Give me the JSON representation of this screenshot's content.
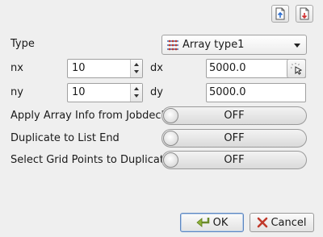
{
  "toolbar": {
    "icons": [
      "import-file-icon",
      "export-file-icon"
    ]
  },
  "form": {
    "type_label": "Type",
    "type_value": "Array type1",
    "nx_label": "nx",
    "nx_value": "10",
    "dx_label": "dx",
    "dx_value": "5000.0",
    "ny_label": "ny",
    "ny_value": "10",
    "dy_label": "dy",
    "dy_value": "5000.0"
  },
  "toggles": [
    {
      "label": "Apply Array Info from Jobdeck",
      "state": "OFF"
    },
    {
      "label": "Duplicate to List End",
      "state": "OFF"
    },
    {
      "label": "Select Grid Points to Duplicate",
      "state": "OFF"
    }
  ],
  "buttons": {
    "ok": "OK",
    "cancel": "Cancel"
  },
  "colors": {
    "background": "#efefef",
    "ok_icon": "#6a8a2a",
    "cancel_icon": "#c0392b",
    "accent": "#3a6fc0"
  }
}
